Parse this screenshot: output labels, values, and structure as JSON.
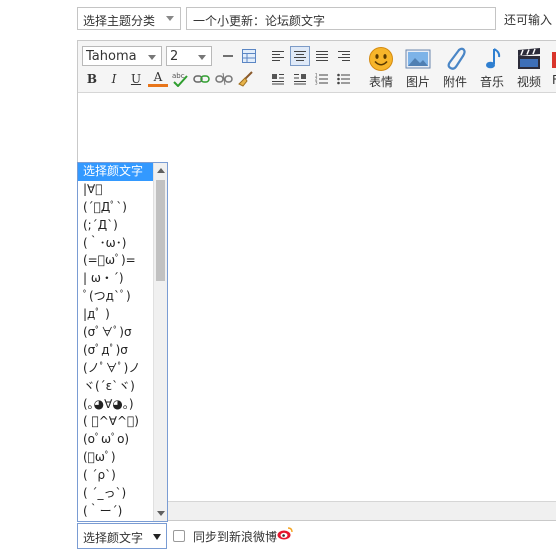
{
  "header": {
    "topic_select": "选择主题分类",
    "title_value": "一个小更新：论坛颜文字",
    "remaining_text": "还可输入"
  },
  "toolbar": {
    "font_family": "Tahoma",
    "font_size": "2",
    "bold": "B",
    "italic": "I",
    "underline": "U",
    "font_color": "A",
    "buttons": [
      {
        "label": "表情",
        "icon": "smiley-icon"
      },
      {
        "label": "图片",
        "icon": "image-icon"
      },
      {
        "label": "附件",
        "icon": "paperclip-icon"
      },
      {
        "label": "音乐",
        "icon": "music-note-icon"
      },
      {
        "label": "视频",
        "icon": "clapperboard-icon"
      },
      {
        "label": "F",
        "icon": "flash-icon"
      }
    ]
  },
  "emoticons": {
    "placeholder": "选择颜文字",
    "items": [
      "选择颜文字",
      "|∀ﾟ",
      "(´ﾟДﾟ`)",
      "(;´Д`)",
      "(｀･ω･)",
      "(=ﾟωﾟ)=",
      "| ω・´)",
      "ﾟ(つд`ﾟ)",
      "|дﾟ )",
      "(σﾟ∀ﾟ)σ",
      "(σﾟдﾟ)σ",
      "(ノﾟ∀ﾟ)ノ",
      "ヾ(´ε`ヾ)",
      "(｡◕∀◕｡)",
      "( ﾟ^∀^ﾟ)",
      "(oﾟωﾟo)",
      "(ﾟωﾟ)",
      "( ´ρ`)",
      "( ´_っ`)",
      "(｀ー´)"
    ]
  },
  "footer": {
    "emoticon_select": "选择颜文字",
    "sync_label": "同步到新浪微博"
  },
  "colors": {
    "selection": "#3399ff",
    "border": "#c4c4c4",
    "toolbar_bg": "#f5f5f5"
  }
}
